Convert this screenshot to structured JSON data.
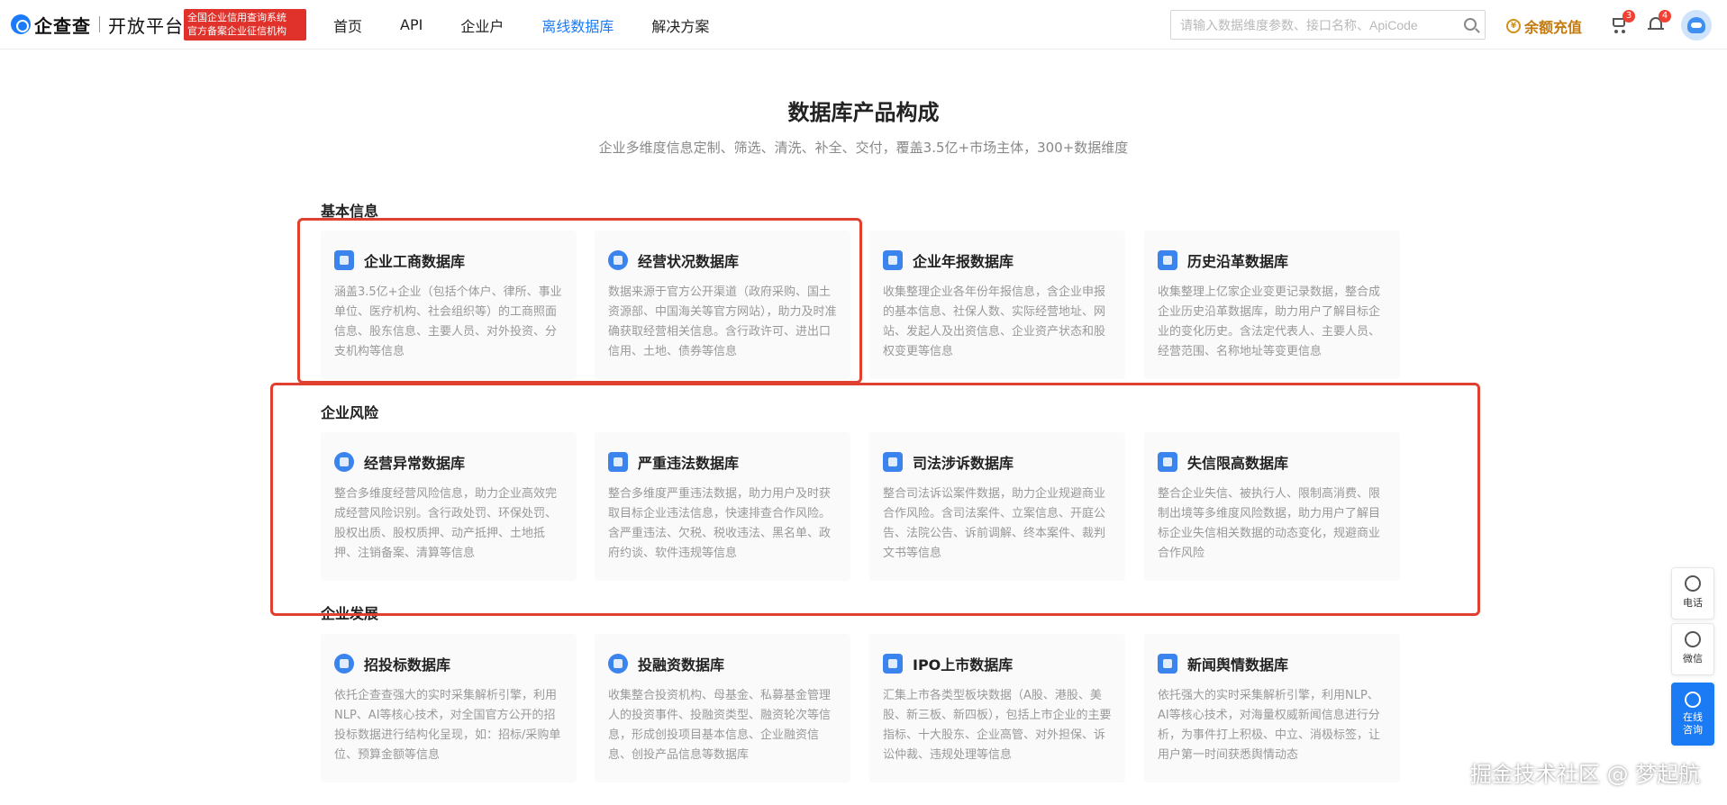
{
  "header": {
    "logo_name": "企查查",
    "logo_sub": "开放平台",
    "cert_line1": "全国企业信用查询系统",
    "cert_line2": "官方备案企业征信机构",
    "nav": [
      "首页",
      "API",
      "企业户",
      "离线数据库",
      "解决方案"
    ],
    "active_nav": "离线数据库",
    "search_placeholder": "请输入数据维度参数、接口名称、ApiCode",
    "recharge_label": "余额充值",
    "cart_count": "3",
    "bell_count": "4"
  },
  "main": {
    "title": "数据库产品构成",
    "subtitle": "企业多维度信息定制、筛选、清洗、补全、交付，覆盖3.5亿+市场主体，300+数据维度"
  },
  "sections": [
    {
      "title": "基本信息",
      "cards": [
        {
          "title": "企业工商数据库",
          "icon": "shield-icon",
          "desc": "涵盖3.5亿+企业（包括个体户、律所、事业单位、医疗机构、社会组织等）的工商照面信息、股东信息、主要人员、对外投资、分支机构等信息"
        },
        {
          "title": "经营状况数据库",
          "icon": "pie-chart-icon",
          "desc": "数据来源于官方公开渠道（政府采购、国土资源部、中国海关等官方网站），助力及时准确获取经营相关信息。含行政许可、进出口信用、土地、债券等信息"
        },
        {
          "title": "企业年报数据库",
          "icon": "report-icon",
          "desc": "收集整理企业各年份年报信息，含企业申报的基本信息、社保人数、实际经营地址、网站、发起人及出资信息、企业资产状态和股权变更等信息"
        },
        {
          "title": "历史沿革数据库",
          "icon": "history-icon",
          "desc": "收集整理上亿家企业变更记录数据，整合成企业历史沿革数据库，助力用户了解目标企业的变化历史。含法定代表人、主要人员、经营范围、名称地址等变更信息"
        }
      ]
    },
    {
      "title": "企业风险",
      "cards": [
        {
          "title": "经营异常数据库",
          "icon": "warning-icon",
          "desc": "整合多维度经营风险信息，助力企业高效完成经营风险识别。含行政处罚、环保处罚、股权出质、股权质押、动产抵押、土地抵押、注销备案、清算等信息"
        },
        {
          "title": "严重违法数据库",
          "icon": "alarm-icon",
          "desc": "整合多维度严重违法数据，助力用户及时获取目标企业违法信息，快速排查合作风险。含严重违法、欠税、税收违法、黑名单、政府约谈、软件违规等信息"
        },
        {
          "title": "司法涉诉数据库",
          "icon": "gavel-icon",
          "desc": "整合司法诉讼案件数据，助力企业规避商业合作风险。含司法案件、立案信息、开庭公告、法院公告、诉前调解、终本案件、裁判文书等信息"
        },
        {
          "title": "失信限高数据库",
          "icon": "dishonest-icon",
          "desc": "整合企业失信、被执行人、限制高消费、限制出境等多维度风险数据，助力用户了解目标企业失信相关数据的动态变化，规避商业合作风险"
        }
      ]
    },
    {
      "title": "企业发展",
      "cards": [
        {
          "title": "招投标数据库",
          "icon": "target-icon",
          "desc": "依托企查查强大的实时采集解析引擎，利用NLP、AI等核心技术，对全国官方公开的招投标数据进行结构化呈现，如：招标/采购单位、预算金额等信息"
        },
        {
          "title": "投融资数据库",
          "icon": "investment-icon",
          "desc": "收集整合投资机构、母基金、私募基金管理人的投资事件、投融资类型、融资轮次等信息，形成创投项目基本信息、企业融资信息、创投产品信息等数据库"
        },
        {
          "title": "IPO上市数据库",
          "icon": "ipo-icon",
          "desc": "汇集上市各类型板块数据（A股、港股、美股、新三板、新四板），包括上市企业的主要指标、十大股东、企业高管、对外担保、诉讼仲裁、违规处理等信息"
        },
        {
          "title": "新闻舆情数据库",
          "icon": "news-icon",
          "desc": "依托强大的实时采集解析引擎，利用NLP、AI等核心技术，对海量权威新闻信息进行分析，为事件打上积极、中立、消极标签，让用户第一时间获悉舆情动态"
        }
      ]
    }
  ],
  "float": {
    "phone_label": "电话",
    "wechat_label": "微信",
    "consult_line1": "在线",
    "consult_line2": "咨询"
  },
  "watermark": "掘金技术社区 @ 梦起航",
  "colors": {
    "accent": "#1b7bf5",
    "highlight_red": "#e0402f",
    "recharge_gold": "#c47a0e"
  }
}
